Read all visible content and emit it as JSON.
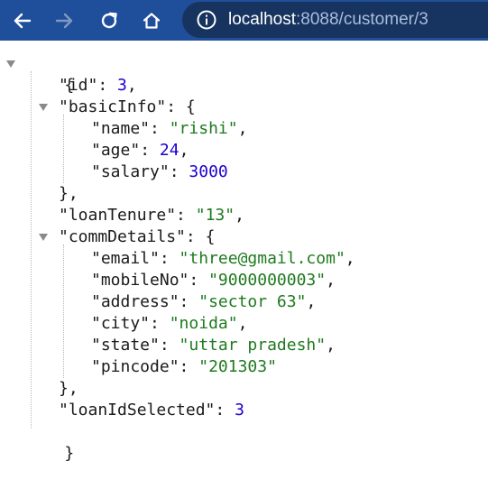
{
  "browser": {
    "url_host": "localhost",
    "url_rest": ":8088/customer/3",
    "back_icon": "arrow-left-icon",
    "forward_icon": "arrow-right-icon",
    "reload_icon": "reload-icon",
    "home_icon": "home-icon",
    "info_icon": "info-icon",
    "toolbar_color": "#1f4f9a",
    "omnibox_color": "#17335f"
  },
  "json": {
    "open_brace": "{",
    "close_brace": "}",
    "id": {
      "key": "\"id\"",
      "value": "3"
    },
    "basicInfo": {
      "key": "\"basicInfo\"",
      "name": {
        "key": "\"name\"",
        "value": "\"rishi\""
      },
      "age": {
        "key": "\"age\"",
        "value": "24"
      },
      "salary": {
        "key": "\"salary\"",
        "value": "3000"
      }
    },
    "loanTenure": {
      "key": "\"loanTenure\"",
      "value": "\"13\""
    },
    "commDetails": {
      "key": "\"commDetails\"",
      "email": {
        "key": "\"email\"",
        "value": "\"three@gmail.com\""
      },
      "mobileNo": {
        "key": "\"mobileNo\"",
        "value": "\"9000000003\""
      },
      "address": {
        "key": "\"address\"",
        "value": "\"sector 63\""
      },
      "city": {
        "key": "\"city\"",
        "value": "\"noida\""
      },
      "state": {
        "key": "\"state\"",
        "value": "\"uttar pradesh\""
      },
      "pincode": {
        "key": "\"pincode\"",
        "value": "\"201303\""
      }
    },
    "loanIdSelected": {
      "key": "\"loanIdSelected\"",
      "value": "3"
    }
  }
}
